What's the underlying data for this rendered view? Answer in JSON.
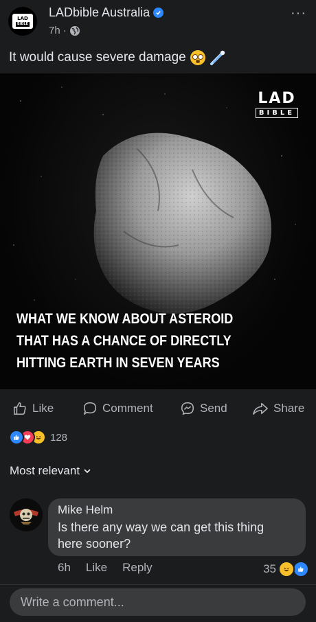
{
  "post": {
    "page_name": "LADbible Australia",
    "time": "7h",
    "separator": "·",
    "caption": "It would cause severe damage",
    "more": "···"
  },
  "image": {
    "watermark_top": "LAD",
    "watermark_bottom": "BIBLE",
    "headline": "WHAT WE KNOW ABOUT ASTEROID THAT HAS A CHANCE OF DIRECTLY HITTING EARTH IN SEVEN YEARS"
  },
  "actions": {
    "like": "Like",
    "comment": "Comment",
    "send": "Send",
    "share": "Share"
  },
  "reactions": {
    "count": "128",
    "types": [
      "like",
      "love",
      "haha"
    ]
  },
  "comments_sort": "Most relevant",
  "comment": {
    "author": "Mike Helm",
    "text": "Is there any way we can get this thing here sooner?",
    "time": "6h",
    "like": "Like",
    "reply": "Reply",
    "reaction_count": "35"
  },
  "composer": {
    "placeholder": "Write a comment..."
  },
  "colors": {
    "background": "#1b1c1e",
    "bubble": "#3a3b3c",
    "verified": "#2d88ff",
    "like_blue": "#2d88ff",
    "love_red": "#f33e58",
    "haha_yellow": "#f7c02b"
  }
}
